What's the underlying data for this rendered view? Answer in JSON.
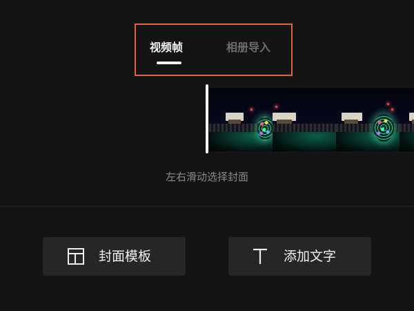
{
  "tabs": {
    "video_frames": "视频帧",
    "album_import": "相册导入",
    "active": "video_frames"
  },
  "filmstrip": {
    "frame_count": 4
  },
  "hint": "左右滑动选择封面",
  "actions": {
    "cover_template": "封面模板",
    "add_text": "添加文字"
  },
  "colors": {
    "background": "#141414",
    "highlight_box": "#e8633a",
    "button_bg": "#262626",
    "active_tab": "#f2f2f2",
    "inactive_tab": "#6e6e6e"
  }
}
